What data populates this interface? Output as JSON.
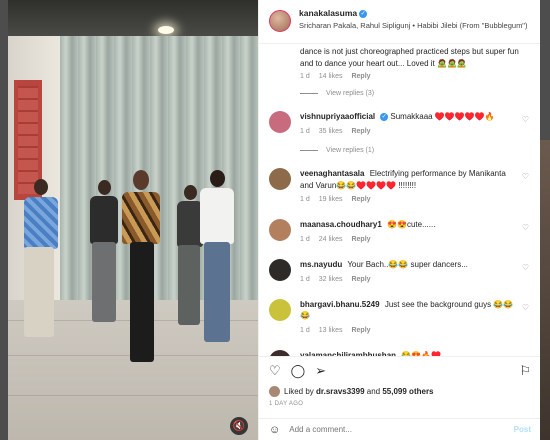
{
  "header": {
    "username": "kanakalasuma",
    "audio": "Sricharan Pakala, Rahul Sipligunj • Habibi Jilebi (From \"Bubblegum\")"
  },
  "top_comment": {
    "text_line1": "dance is not just choreographed practiced steps but super fun",
    "text_line2": "and to dance your heart out... Loved it 🧟🧟🧟",
    "time": "1 d",
    "likes": "14 likes",
    "reply": "Reply",
    "view_replies": "View replies (3)"
  },
  "comments": [
    {
      "user": "vishnupriyaaofficial",
      "verified": true,
      "text": "Sumakkaaa ♥️♥️♥️♥️♥️🔥",
      "time": "1 d",
      "likes": "35 likes",
      "reply": "Reply",
      "view_replies": "View replies (1)",
      "avatar_color": "#c86b7f"
    },
    {
      "user": "veenaghantasala",
      "text": "Electrifying performance by Manikanta and Varun😂😂♥️♥️♥️♥️ !!!!!!!!",
      "time": "1 d",
      "likes": "19 likes",
      "reply": "Reply",
      "avatar_color": "#8d6a4a"
    },
    {
      "user": "maanasa.choudhary1",
      "text": "😍😍cute......",
      "time": "1 d",
      "likes": "24 likes",
      "reply": "Reply",
      "avatar_color": "#b3805f"
    },
    {
      "user": "ms.nayudu",
      "text": "Your Bach..😂😂 super dancers...",
      "time": "1 d",
      "likes": "32 likes",
      "reply": "Reply",
      "avatar_color": "#2e2a28"
    },
    {
      "user": "bhargavi.bhanu.5249",
      "text": "Just see the background guys 😂😂😂",
      "time": "1 d",
      "likes": "13 likes",
      "reply": "Reply",
      "avatar_color": "#c9c23a"
    },
    {
      "user": "yalamanchilirambhushan",
      "text": "😂😍🔥♥️",
      "time": "",
      "likes": "",
      "reply": "",
      "avatar_color": "#3c2d2a"
    }
  ],
  "actions": {
    "liked_by_prefix": "Liked by ",
    "liked_by_user": "dr.sravs3399",
    "liked_by_mid": " and ",
    "liked_by_count": "55,099 others",
    "date": "1 DAY AGO"
  },
  "add_comment": {
    "placeholder": "Add a comment...",
    "post_label": "Post"
  },
  "icons": {
    "heart": "heart-icon",
    "comment": "comment-icon",
    "share": "share-icon",
    "bookmark": "bookmark-icon",
    "emoji": "emoji-icon",
    "mute": "mute-icon"
  }
}
